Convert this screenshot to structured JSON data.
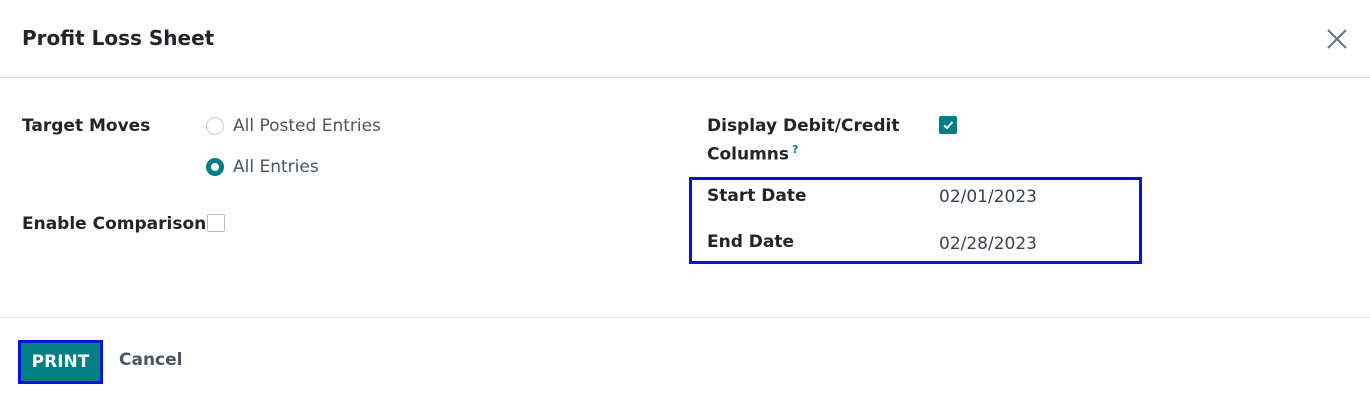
{
  "dialog": {
    "title": "Profit Loss Sheet",
    "close_icon": "close-icon"
  },
  "form": {
    "target_moves": {
      "label": "Target Moves",
      "options": [
        {
          "label": "All Posted Entries",
          "selected": false
        },
        {
          "label": "All Entries",
          "selected": true
        }
      ]
    },
    "enable_comparison": {
      "label": "Enable Comparison",
      "checked": false
    },
    "display_debit_credit": {
      "label_line1": "Display Debit/Credit",
      "label_line2": "Columns",
      "help": "?",
      "checked": true
    },
    "start_date": {
      "label": "Start Date",
      "value": "02/01/2023"
    },
    "end_date": {
      "label": "End Date",
      "value": "02/28/2023"
    }
  },
  "footer": {
    "print_label": "PRINT",
    "cancel_label": "Cancel"
  },
  "colors": {
    "accent": "#017e84",
    "highlight": "#0a13d8"
  }
}
